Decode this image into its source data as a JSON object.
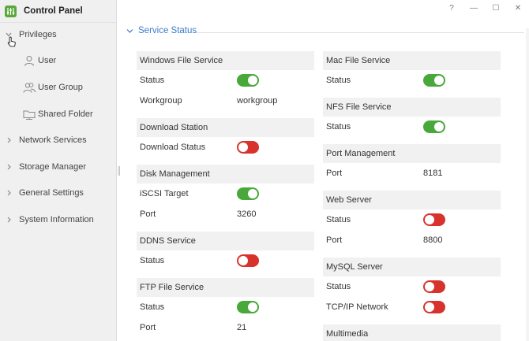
{
  "app": {
    "title": "Control Panel",
    "icon": "sliders-icon"
  },
  "window_controls": {
    "help": "?",
    "minimize": "—",
    "maximize": "☐",
    "close": "✕"
  },
  "sidebar": {
    "groups": [
      {
        "label": "Privileges",
        "expanded": true
      },
      {
        "label": "Network Services"
      },
      {
        "label": "Storage Manager"
      },
      {
        "label": "General Settings"
      },
      {
        "label": "System Information"
      }
    ],
    "sub_items": [
      {
        "label": "User",
        "icon": "user-icon"
      },
      {
        "label": "User Group",
        "icon": "user-group-icon"
      },
      {
        "label": "Shared Folder",
        "icon": "shared-folder-icon"
      }
    ]
  },
  "section": {
    "title": "Service Status"
  },
  "left_cards": [
    {
      "title": "Windows File Service",
      "rows": [
        {
          "key": "Status",
          "toggle": "on"
        },
        {
          "key": "Workgroup",
          "value": "workgroup"
        }
      ]
    },
    {
      "title": "Download Station",
      "rows": [
        {
          "key": "Download Status",
          "toggle": "off"
        }
      ]
    },
    {
      "title": "Disk Management",
      "rows": [
        {
          "key": "iSCSI Target",
          "toggle": "on"
        },
        {
          "key": "Port",
          "value": "3260"
        }
      ]
    },
    {
      "title": "DDNS Service",
      "rows": [
        {
          "key": "Status",
          "toggle": "off"
        }
      ]
    },
    {
      "title": "FTP File Service",
      "rows": [
        {
          "key": "Status",
          "toggle": "on"
        },
        {
          "key": "Port",
          "value": "21"
        }
      ]
    }
  ],
  "right_cards": [
    {
      "title": "Mac File Service",
      "rows": [
        {
          "key": "Status",
          "toggle": "on"
        }
      ]
    },
    {
      "title": "NFS File Service",
      "rows": [
        {
          "key": "Status",
          "toggle": "on"
        }
      ]
    },
    {
      "title": "Port Management",
      "rows": [
        {
          "key": "Port",
          "value": "8181"
        }
      ]
    },
    {
      "title": "Web Server",
      "rows": [
        {
          "key": "Status",
          "toggle": "off"
        },
        {
          "key": "Port",
          "value": "8800"
        }
      ]
    },
    {
      "title": "MySQL Server",
      "rows": [
        {
          "key": "Status",
          "toggle": "off"
        },
        {
          "key": "TCP/IP Network",
          "toggle": "off"
        }
      ]
    },
    {
      "title": "Multimedia",
      "rows": []
    }
  ],
  "colors": {
    "accent": "#3a7cc8",
    "toggle_on": "#48a83a",
    "toggle_off": "#d8322c",
    "sidebar_bg": "#f0f0f0",
    "card_header_bg": "#f1f1f1"
  }
}
